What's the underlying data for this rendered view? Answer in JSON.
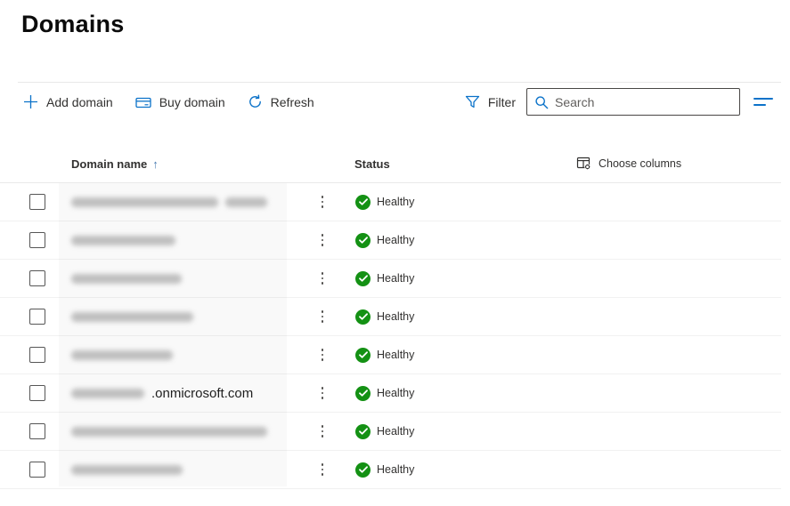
{
  "page": {
    "title": "Domains"
  },
  "colors": {
    "accent": "#0b72c9",
    "healthy_green": "#149114",
    "text": "#323130",
    "text_secondary": "#605e5c"
  },
  "toolbar": {
    "add_domain_label": "Add domain",
    "buy_domain_label": "Buy domain",
    "refresh_label": "Refresh",
    "filter_label": "Filter",
    "search_placeholder": "Search",
    "search_value": ""
  },
  "table": {
    "domain_column_label": "Domain name",
    "sort_direction": "ascending",
    "sort_arrow": "↑",
    "status_column_label": "Status",
    "choose_columns_label": "Choose columns",
    "rows": [
      {
        "domain_redacted": true,
        "redaction_widths": [
          165,
          47
        ],
        "domain_visible_text": "",
        "status": "Healthy"
      },
      {
        "domain_redacted": true,
        "redaction_widths": [
          117
        ],
        "domain_visible_text": "",
        "status": "Healthy"
      },
      {
        "domain_redacted": true,
        "redaction_widths": [
          124
        ],
        "domain_visible_text": "",
        "status": "Healthy"
      },
      {
        "domain_redacted": true,
        "redaction_widths": [
          137
        ],
        "domain_visible_text": "",
        "status": "Healthy"
      },
      {
        "domain_redacted": true,
        "redaction_widths": [
          114
        ],
        "domain_visible_text": "",
        "status": "Healthy"
      },
      {
        "domain_redacted": true,
        "redaction_widths": [
          82
        ],
        "domain_visible_text": ".onmicrosoft.com",
        "status": "Healthy"
      },
      {
        "domain_redacted": true,
        "redaction_widths": [
          220
        ],
        "domain_visible_text": "",
        "status": "Healthy"
      },
      {
        "domain_redacted": true,
        "redaction_widths": [
          125
        ],
        "domain_visible_text": "",
        "status": "Healthy"
      }
    ]
  }
}
